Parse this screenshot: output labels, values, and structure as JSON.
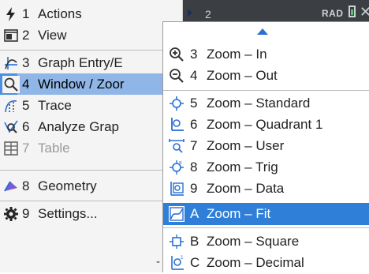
{
  "background": {
    "topbar_text": "2",
    "mode": "RAD"
  },
  "menu": {
    "items": [
      {
        "key": "1",
        "label": "Actions",
        "icon": "lightning-icon"
      },
      {
        "key": "2",
        "label": "View",
        "icon": "view-icon"
      },
      {
        "key": "3",
        "label": "Graph Entry/E",
        "icon": "graph-entry-icon"
      },
      {
        "key": "4",
        "label": "Window / Zoor",
        "icon": "magnifier-icon"
      },
      {
        "key": "5",
        "label": "Trace",
        "icon": "trace-icon"
      },
      {
        "key": "6",
        "label": "Analyze Grap",
        "icon": "analyze-icon"
      },
      {
        "key": "7",
        "label": "Table",
        "icon": "table-icon"
      },
      {
        "key": "8",
        "label": "Geometry",
        "icon": "geometry-icon"
      },
      {
        "key": "9",
        "label": "Settings...",
        "icon": "gear-icon"
      }
    ],
    "selected_key": "4",
    "truncation": "-"
  },
  "submenu": {
    "items": [
      {
        "key": "3",
        "label": "Zoom – In",
        "icon": "zoom-in-icon"
      },
      {
        "key": "4",
        "label": "Zoom – Out",
        "icon": "zoom-out-icon"
      },
      {
        "key": "5",
        "label": "Zoom – Standard",
        "icon": "zoom-standard-icon"
      },
      {
        "key": "6",
        "label": "Zoom – Quadrant 1",
        "icon": "zoom-quadrant-icon"
      },
      {
        "key": "7",
        "label": "Zoom – User",
        "icon": "zoom-user-icon"
      },
      {
        "key": "8",
        "label": "Zoom – Trig",
        "icon": "zoom-trig-icon"
      },
      {
        "key": "9",
        "label": "Zoom – Data",
        "icon": "zoom-data-icon"
      },
      {
        "key": "A",
        "label": "Zoom – Fit",
        "icon": "zoom-fit-icon"
      },
      {
        "key": "B",
        "label": "Zoom – Square",
        "icon": "zoom-square-icon"
      },
      {
        "key": "C",
        "label": "Zoom – Decimal",
        "icon": "zoom-decimal-icon"
      }
    ],
    "selected_key": "A"
  },
  "colors": {
    "selection_blue": "#2f7fd8",
    "parent_highlight": "#8fb6e6",
    "icon_blue": "#2a6fd6",
    "text": "#222222",
    "disabled": "#9a9a9a"
  }
}
